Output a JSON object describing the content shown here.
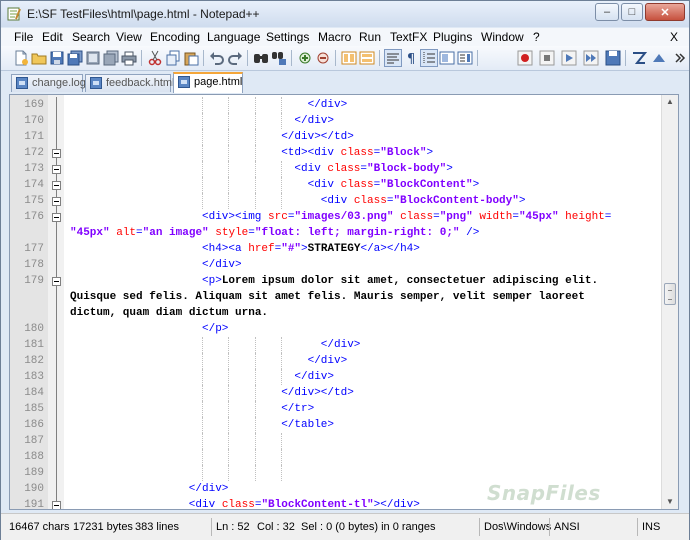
{
  "window": {
    "title": "E:\\SF TestFiles\\html\\page.html - Notepad++",
    "controls": {
      "minimize": "–",
      "maximize": "□",
      "close": "✕"
    }
  },
  "menu": {
    "items": [
      "File",
      "Edit",
      "Search",
      "View",
      "Encoding",
      "Language",
      "Settings",
      "Macro",
      "Run",
      "TextFX",
      "Plugins",
      "Window",
      "?"
    ],
    "close_doc": "X"
  },
  "toolbar": {
    "icons": [
      "new-file-icon",
      "open-file-icon",
      "save-icon",
      "save-all-icon",
      "close-icon",
      "close-all-icon",
      "print-icon",
      "cut-icon",
      "copy-icon",
      "paste-icon",
      "undo-icon",
      "redo-icon",
      "find-icon",
      "replace-icon",
      "zoom-in-icon",
      "zoom-out-icon",
      "sync-vertical-icon",
      "sync-horizontal-icon",
      "word-wrap-icon",
      "show-all-chars-icon",
      "indent-guide-icon",
      "user-lang-icon",
      "doc-map-icon",
      "record-macro-icon",
      "stop-record-icon",
      "play-macro-icon",
      "play-multiple-icon",
      "save-macro-icon",
      "trim-icon",
      "up-icon"
    ]
  },
  "tabs": [
    {
      "label": "change.log",
      "active": false
    },
    {
      "label": "feedback.html",
      "active": false
    },
    {
      "label": "page.html",
      "active": true
    }
  ],
  "editor": {
    "lines": [
      {
        "num": "169",
        "indent": 36,
        "fold": "line",
        "segments": [
          {
            "t": "tag",
            "v": "</div>"
          }
        ]
      },
      {
        "num": "170",
        "indent": 34,
        "fold": "line",
        "segments": [
          {
            "t": "tag",
            "v": "</div>"
          }
        ]
      },
      {
        "num": "171",
        "indent": 32,
        "fold": "line",
        "segments": [
          {
            "t": "tag",
            "v": "</div></td>"
          }
        ]
      },
      {
        "num": "172",
        "indent": 32,
        "fold": "box",
        "segments": [
          {
            "t": "tag",
            "v": "<td><div "
          },
          {
            "t": "attr",
            "v": "class"
          },
          {
            "t": "tag",
            "v": "="
          },
          {
            "t": "val",
            "v": "\"Block\""
          },
          {
            "t": "tag",
            "v": ">"
          }
        ]
      },
      {
        "num": "173",
        "indent": 34,
        "fold": "box",
        "segments": [
          {
            "t": "tag",
            "v": "<div "
          },
          {
            "t": "attr",
            "v": "class"
          },
          {
            "t": "tag",
            "v": "="
          },
          {
            "t": "val",
            "v": "\"Block-body\""
          },
          {
            "t": "tag",
            "v": ">"
          }
        ]
      },
      {
        "num": "174",
        "indent": 36,
        "fold": "box",
        "segments": [
          {
            "t": "tag",
            "v": "<div "
          },
          {
            "t": "attr",
            "v": "class"
          },
          {
            "t": "tag",
            "v": "="
          },
          {
            "t": "val",
            "v": "\"BlockContent\""
          },
          {
            "t": "tag",
            "v": ">"
          }
        ]
      },
      {
        "num": "175",
        "indent": 38,
        "fold": "box",
        "segments": [
          {
            "t": "tag",
            "v": "<div "
          },
          {
            "t": "attr",
            "v": "class"
          },
          {
            "t": "tag",
            "v": "="
          },
          {
            "t": "val",
            "v": "\"BlockContent-body\""
          },
          {
            "t": "tag",
            "v": ">"
          }
        ]
      },
      {
        "num": "176",
        "indent": 20,
        "fold": "box",
        "segments": [
          {
            "t": "tag",
            "v": "<div><img "
          },
          {
            "t": "attr",
            "v": "src"
          },
          {
            "t": "tag",
            "v": "="
          },
          {
            "t": "val",
            "v": "\"images/03.png\""
          },
          {
            "t": "tag",
            "v": " "
          },
          {
            "t": "attr",
            "v": "class"
          },
          {
            "t": "tag",
            "v": "="
          },
          {
            "t": "val",
            "v": "\"png\""
          },
          {
            "t": "tag",
            "v": " "
          },
          {
            "t": "attr",
            "v": "width"
          },
          {
            "t": "tag",
            "v": "="
          },
          {
            "t": "val",
            "v": "\"45px\""
          },
          {
            "t": "tag",
            "v": " "
          },
          {
            "t": "attr",
            "v": "height"
          },
          {
            "t": "tag",
            "v": "="
          }
        ]
      },
      {
        "num": "",
        "indent": 0,
        "fold": "line",
        "segments": [
          {
            "t": "val",
            "v": "\"45px\""
          },
          {
            "t": "tag",
            "v": " "
          },
          {
            "t": "attr",
            "v": "alt"
          },
          {
            "t": "tag",
            "v": "="
          },
          {
            "t": "val",
            "v": "\"an image\""
          },
          {
            "t": "tag",
            "v": " "
          },
          {
            "t": "attr",
            "v": "style"
          },
          {
            "t": "tag",
            "v": "="
          },
          {
            "t": "val",
            "v": "\"float: left; margin-right: 0;\""
          },
          {
            "t": "tag",
            "v": " />"
          }
        ]
      },
      {
        "num": "177",
        "indent": 20,
        "fold": "line",
        "segments": [
          {
            "t": "tag",
            "v": "<h4><a "
          },
          {
            "t": "attr",
            "v": "href"
          },
          {
            "t": "tag",
            "v": "="
          },
          {
            "t": "val",
            "v": "\"#\""
          },
          {
            "t": "tag",
            "v": ">"
          },
          {
            "t": "text",
            "v": "STRATEGY"
          },
          {
            "t": "tag",
            "v": "</a></h4>"
          }
        ]
      },
      {
        "num": "178",
        "indent": 20,
        "fold": "line",
        "segments": [
          {
            "t": "tag",
            "v": "</div>"
          }
        ]
      },
      {
        "num": "179",
        "indent": 20,
        "fold": "box",
        "segments": [
          {
            "t": "tag",
            "v": "<p>"
          },
          {
            "t": "text",
            "v": "Lorem ipsum dolor sit amet, consectetuer adipiscing elit."
          }
        ]
      },
      {
        "num": "",
        "indent": 0,
        "fold": "line",
        "segments": [
          {
            "t": "text",
            "v": "Quisque sed felis. Aliquam sit amet felis. Mauris semper, velit semper laoreet"
          }
        ]
      },
      {
        "num": "",
        "indent": 0,
        "fold": "line",
        "segments": [
          {
            "t": "text",
            "v": "dictum, quam diam dictum urna."
          }
        ]
      },
      {
        "num": "180",
        "indent": 20,
        "fold": "line",
        "segments": [
          {
            "t": "tag",
            "v": "</p>"
          }
        ]
      },
      {
        "num": "181",
        "indent": 38,
        "fold": "line",
        "segments": [
          {
            "t": "tag",
            "v": "</div>"
          }
        ]
      },
      {
        "num": "182",
        "indent": 36,
        "fold": "line",
        "segments": [
          {
            "t": "tag",
            "v": "</div>"
          }
        ]
      },
      {
        "num": "183",
        "indent": 34,
        "fold": "line",
        "segments": [
          {
            "t": "tag",
            "v": "</div>"
          }
        ]
      },
      {
        "num": "184",
        "indent": 32,
        "fold": "line",
        "segments": [
          {
            "t": "tag",
            "v": "</div></td>"
          }
        ]
      },
      {
        "num": "185",
        "indent": 32,
        "fold": "line",
        "segments": [
          {
            "t": "tag",
            "v": "</tr>"
          }
        ]
      },
      {
        "num": "186",
        "indent": 32,
        "fold": "line",
        "segments": [
          {
            "t": "tag",
            "v": "</table>"
          }
        ]
      },
      {
        "num": "187",
        "indent": 0,
        "fold": "line",
        "segments": []
      },
      {
        "num": "188",
        "indent": 0,
        "fold": "line",
        "segments": []
      },
      {
        "num": "189",
        "indent": 0,
        "fold": "line",
        "segments": []
      },
      {
        "num": "190",
        "indent": 18,
        "fold": "line",
        "segments": [
          {
            "t": "tag",
            "v": "</div>"
          }
        ]
      },
      {
        "num": "191",
        "indent": 18,
        "fold": "box",
        "segments": [
          {
            "t": "tag",
            "v": "<div "
          },
          {
            "t": "attr",
            "v": "class"
          },
          {
            "t": "tag",
            "v": "="
          },
          {
            "t": "val",
            "v": "\"BlockContent-tl\""
          },
          {
            "t": "tag",
            "v": "></div>"
          }
        ]
      }
    ]
  },
  "watermark": "SnapFiles",
  "status": {
    "chars": "16467 chars",
    "bytes": "17231 bytes",
    "lines": "383 lines",
    "ln": "Ln : 52",
    "col": "Col : 32",
    "sel": "Sel : 0 (0 bytes) in 0 ranges",
    "eol": "Dos\\Windows",
    "encoding": "ANSI",
    "mode": "INS"
  }
}
